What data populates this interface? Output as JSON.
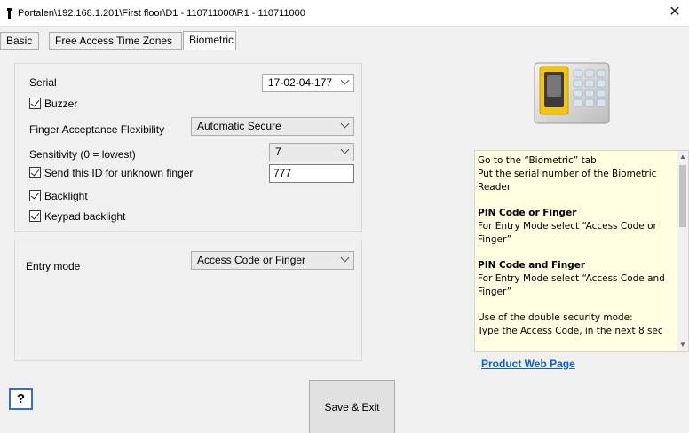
{
  "window": {
    "title": "Portalen\\192.168.1.201\\First floor\\D1 - 110711000\\R1 - 110711000",
    "close_glyph": "✕"
  },
  "tabs": [
    {
      "label": "Basic",
      "active": false
    },
    {
      "label": "Free Access Time Zones",
      "active": false
    },
    {
      "label": "Biometric",
      "active": true
    }
  ],
  "biometric": {
    "serial_label": "Serial",
    "serial_value": "17-02-04-177",
    "buzzer_label": "Buzzer",
    "buzzer_checked": true,
    "flexibility_label": "Finger Acceptance Flexibility",
    "flexibility_value": "Automatic Secure",
    "sensitivity_label": "Sensitivity (0 = lowest)",
    "sensitivity_value": "7",
    "unknown_finger_label": "Send this ID for unknown finger",
    "unknown_finger_checked": true,
    "unknown_finger_value": "777",
    "backlight_label": "Backlight",
    "backlight_checked": true,
    "keypad_backlight_label": "Keypad backlight",
    "keypad_backlight_checked": true
  },
  "entry": {
    "label": "Entry mode",
    "value": "Access Code or Finger"
  },
  "help": {
    "line1": "Go to the “Biometric” tab",
    "line2": "Put the serial number of the Biometric Reader",
    "pin_or_heading": "PIN Code or Finger",
    "pin_or_text": "For Entry Mode select “Access Code or Finger”",
    "pin_and_heading": "PIN Code and Finger",
    "pin_and_text": "For Entry Mode select “Access Code and Finger”",
    "double_heading": "Use of the double security mode:",
    "double_text": "Type the Access Code, in the next 8 sec"
  },
  "product_link": "Product Web Page",
  "buttons": {
    "save_exit": "Save & Exit",
    "help": "?"
  },
  "icons": {
    "device_image": "biometric-reader-device",
    "dropdown": "chevron-down-icon",
    "scroll_up": "scroll-up-arrow-icon",
    "scroll_down": "scroll-down-arrow-icon"
  },
  "colors": {
    "link": "#0b61c5",
    "help_background": "#ffffe1",
    "help_button_border": "#3b6fc4",
    "device_accent": "#f2c40f"
  }
}
